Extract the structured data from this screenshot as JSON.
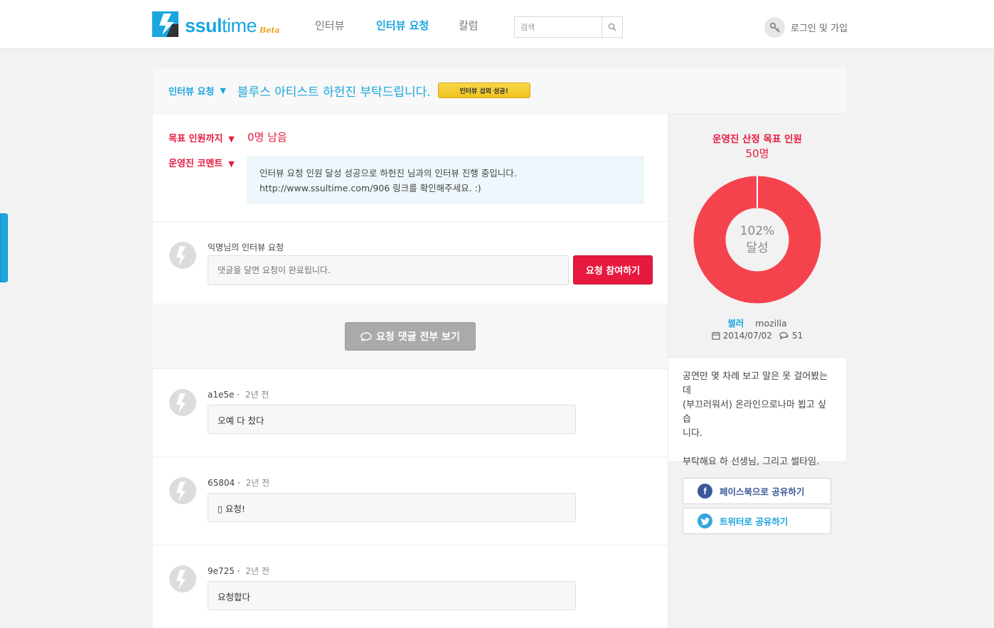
{
  "header": {
    "logo_text": "ssultime",
    "logo_beta": "Beta",
    "nav": [
      "인터뷰",
      "인터뷰 요청",
      "칼럼"
    ],
    "active_nav": "인터뷰 요청",
    "search_placeholder": "검색",
    "login_label": "로그인 및 가입"
  },
  "request": {
    "crumb": "인터뷰 요청",
    "title": "블루스 아티스트 하헌진 부탁드립니다.",
    "badge": "인터뷰 섭외 성공!",
    "goal_label": "목표 인원까지",
    "remaining": "0명 남음",
    "staff_comment_label": "운영진 코멘트",
    "staff_comment_line1": "인터뷰 요청 인원 달성 성공으로 하헌진 님과의 인터뷰 진행 중입니다.",
    "staff_comment_line2": "http://www.ssultime.com/906 링크를 확인해주세요. :)"
  },
  "write": {
    "name": "익명님의 인터뷰 요청",
    "placeholder": "댓글을 달면 요청이 완료됩니다.",
    "button": "요청 참여하기"
  },
  "view_all_button": "요청 댓글 전부 보기",
  "comments": [
    {
      "author": "a1e5e",
      "sep": "·",
      "time": "2년 전",
      "text": "오예 다 찼다"
    },
    {
      "author": "65804",
      "sep": "·",
      "time": "2년 전",
      "text": "▯ 요청!"
    },
    {
      "author": "9e725",
      "sep": "·",
      "time": "2년 전",
      "text": "요청합다"
    }
  ],
  "goal_panel": {
    "title": "운영진 산정 목표 인원",
    "count": "50명",
    "percent": "102%",
    "percent_value": 102,
    "status": "달성",
    "role": "썰러",
    "author": "mozilla",
    "date": "2014/07/02",
    "comment_count": "51"
  },
  "description": {
    "line1": "공연만 몇 차례 보고 말은 못 걸어봤는데",
    "line2": "(부끄러워서) 온라인으로나마 뵙고 싶습",
    "line3": "니다.",
    "line4": "부탁해요 하 선생님, 그리고 썰타임."
  },
  "share": {
    "facebook": "페이스북으로 공유하기",
    "twitter": "트위터로 공유하기"
  },
  "colors": {
    "accent": "#1aa6df",
    "red": "#e8193f",
    "donut": "#f5434e",
    "badge": "#f2cb2b"
  }
}
